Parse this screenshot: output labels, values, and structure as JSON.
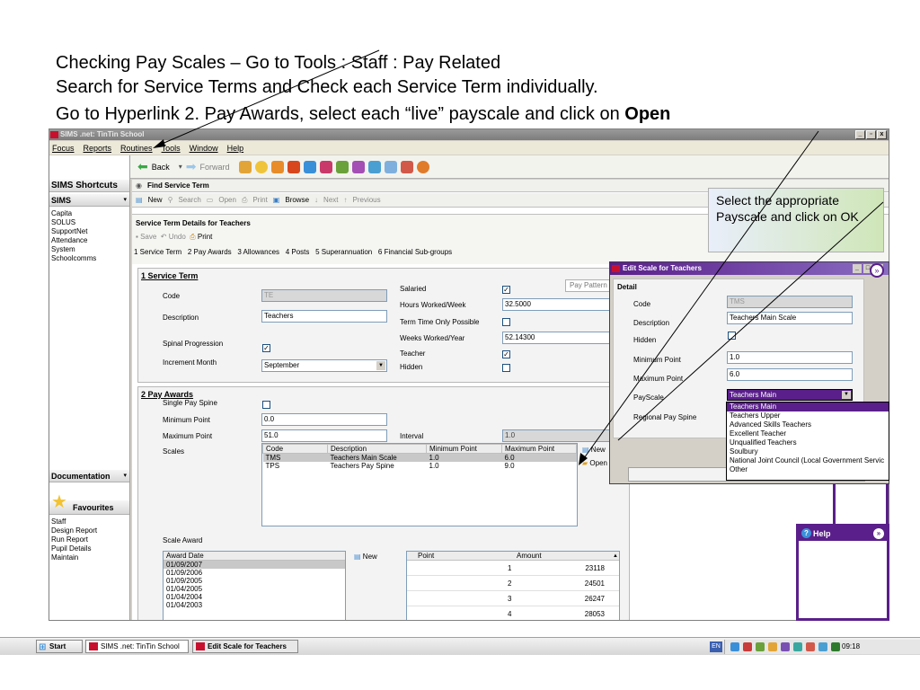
{
  "caption": {
    "line1": "Checking Pay Scales – Go to Tools : Staff : Pay Related",
    "line2": "Search for Service Terms and Check each Service Term individually.",
    "line3_pre": "Go to Hyperlink 2. Pay Awards, select each “live” payscale and click on ",
    "line3_bold": "Open"
  },
  "window": {
    "title": "SIMS .net: TinTin School",
    "controls": [
      "_",
      "▫",
      "x"
    ]
  },
  "menu": [
    "Focus",
    "Reports",
    "Routines",
    "Tools",
    "Window",
    "Help"
  ],
  "toolbar": {
    "back": "Back",
    "forward": "Forward"
  },
  "sidebar": {
    "heading": "SIMS Shortcuts",
    "group": "SIMS",
    "items": [
      "Capita",
      "SOLUS",
      "SupportNet",
      "Attendance",
      "System",
      "Schoolcomms"
    ],
    "documentation": "Documentation",
    "favourites": "Favourites",
    "fav_items": [
      "Staff",
      "Design Report",
      "Run Report",
      "Pupil Details",
      "Maintain"
    ]
  },
  "find": {
    "title": "Find Service Term",
    "actions": [
      "New",
      "Search",
      "Open",
      "Print",
      "Browse",
      "Next",
      "Previous"
    ]
  },
  "details": {
    "title": "Service Term Details for Teachers",
    "actions": [
      "Save",
      "Undo",
      "Print"
    ],
    "links": [
      "1 Service Term",
      "2 Pay Awards",
      "3 Allowances",
      "4 Posts",
      "5 Superannuation",
      "6 Financial Sub-groups"
    ]
  },
  "service_term": {
    "heading": "1 Service Term",
    "code_label": "Code",
    "code_value": "TE",
    "desc_label": "Description",
    "desc_value": "Teachers",
    "spinal_label": "Spinal Progression",
    "increment_label": "Increment Month",
    "increment_value": "September",
    "salaried_label": "Salaried",
    "hours_label": "Hours Worked/Week",
    "hours_value": "32.5000",
    "term_only_label": "Term Time Only Possible",
    "weeks_label": "Weeks Worked/Year",
    "weeks_value": "52.14300",
    "teacher_label": "Teacher",
    "hidden_label": "Hidden",
    "pay_pattern": "Pay Pattern"
  },
  "pay_awards": {
    "heading": "2 Pay Awards",
    "single_label": "Single Pay Spine",
    "min_label": "Minimum Point",
    "min_value": "0.0",
    "max_label": "Maximum Point",
    "max_value": "51.0",
    "interval_label": "Interval",
    "interval_value": "1.0",
    "scales_label": "Scales",
    "scales_columns": [
      "Code",
      "Description",
      "Minimum Point",
      "Maximum Point"
    ],
    "scales_rows": [
      [
        "TMS",
        "Teachers Main Scale",
        "1.0",
        "6.0"
      ],
      [
        "TPS",
        "Teachers Pay Spine",
        "1.0",
        "9.0"
      ]
    ],
    "new_btn": "New",
    "open_btn": "Open",
    "scale_award_label": "Scale Award",
    "award_header": "Award Date",
    "award_dates": [
      "01/09/2007",
      "01/09/2006",
      "01/09/2005",
      "01/04/2005",
      "01/04/2004",
      "01/04/2003"
    ],
    "award_new": "New",
    "point_header": "Point",
    "amount_header": "Amount",
    "point_rows": [
      [
        "1",
        "23118"
      ],
      [
        "2",
        "24501"
      ],
      [
        "3",
        "26247"
      ],
      [
        "4",
        "28053"
      ]
    ]
  },
  "dialog": {
    "title": "Edit Scale for Teachers",
    "section": "Detail",
    "code_label": "Code",
    "code_value": "TMS",
    "desc_label": "Description",
    "desc_value": "Teachers Main Scale",
    "hidden_label": "Hidden",
    "min_label": "Minimum Point",
    "min_value": "1.0",
    "max_label": "Maximum Point",
    "max_value": "6.0",
    "payscale_label": "PayScale",
    "payscale_value": "Teachers Main",
    "regional_label": "Regional Pay Spine",
    "options": [
      "Teachers Main",
      "Teachers Upper",
      "Advanced Skills Teachers",
      "Excellent Teacher",
      "Unqualified Teachers",
      "Soulbury",
      "National Joint Council (Local Government Servic",
      "Other"
    ]
  },
  "callout": "Select the appropriate Payscale and click on OK",
  "help": {
    "label": "Help"
  },
  "taskbar": {
    "start": "Start",
    "tasks": [
      "SIMS .net: TinTin School",
      "Edit Scale for Teachers"
    ],
    "lang": "EN",
    "clock": "09:18"
  },
  "colors": {
    "sims_purple": "#5a1f8a",
    "sims_red": "#c8102e",
    "link_blue": "#1c5180"
  }
}
